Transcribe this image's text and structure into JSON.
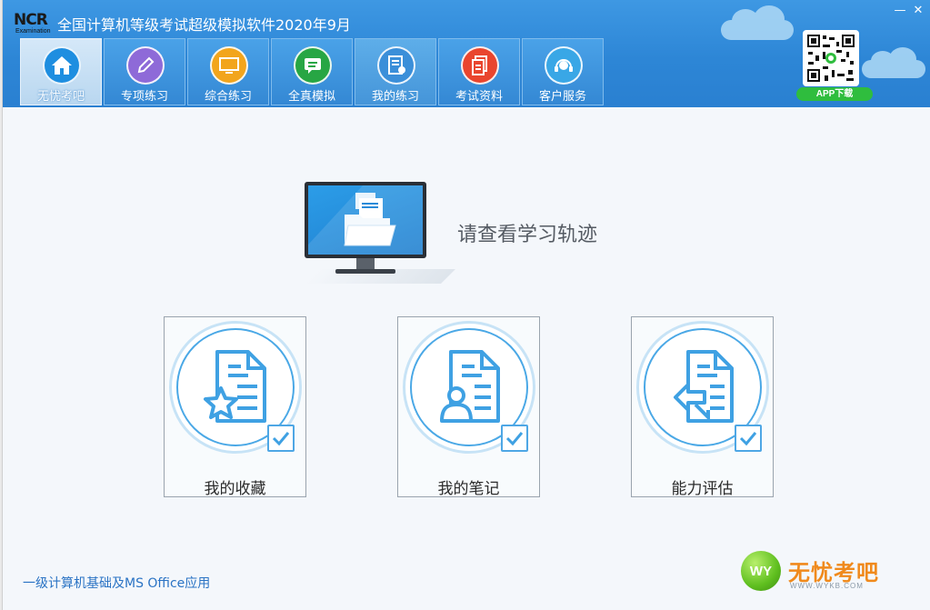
{
  "window": {
    "title": "全国计算机等级考试超级模拟软件2020年9月",
    "logo_text": "NCR",
    "logo_sub": "Examination"
  },
  "tabs": [
    {
      "label": "无忧考吧",
      "icon": "home-icon",
      "color": "#1e8ee0",
      "active": true
    },
    {
      "label": "专项练习",
      "icon": "pencil-icon",
      "color": "#8e6ad8"
    },
    {
      "label": "综合练习",
      "icon": "monitor-icon",
      "color": "#f2a51c"
    },
    {
      "label": "全真模拟",
      "icon": "chat-icon",
      "color": "#27a644"
    },
    {
      "label": "我的练习",
      "icon": "document-user-icon",
      "color": "#3b8fd9"
    },
    {
      "label": "考试资料",
      "icon": "files-icon",
      "color": "#e9452e"
    },
    {
      "label": "客户服务",
      "icon": "headset-icon",
      "color": "#39a7e6"
    }
  ],
  "app_download": {
    "label": "APP下载"
  },
  "main": {
    "prompt": "请查看学习轨迹",
    "cards": [
      {
        "label": "我的收藏",
        "icon": "favorite-document-icon"
      },
      {
        "label": "我的笔记",
        "icon": "user-document-icon"
      },
      {
        "label": "能力评估",
        "icon": "assessment-document-icon"
      }
    ]
  },
  "footer": {
    "subject": "一级计算机基础及MS Office应用",
    "brand_name": "无忧考吧",
    "brand_ball": "WY",
    "brand_url": "WWW.WYKB.COM"
  },
  "colors": {
    "header": "#2d86d6",
    "accent": "#4aa8e6",
    "brand": "#f08a1c"
  }
}
